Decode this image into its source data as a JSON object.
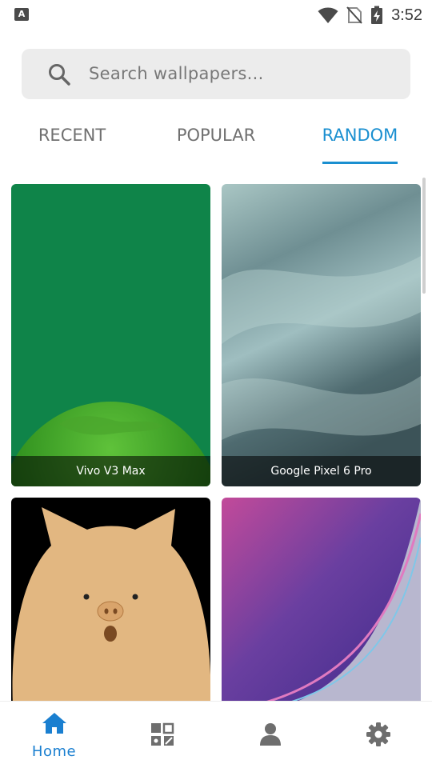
{
  "status_bar": {
    "time": "3:52",
    "left_icon": "A",
    "icons": [
      "wifi-icon",
      "no-sim-icon",
      "battery-charging-icon"
    ]
  },
  "search": {
    "placeholder": "Search wallpapers...",
    "icon": "search-icon"
  },
  "tabs": [
    {
      "label": "RECENT",
      "active": false
    },
    {
      "label": "POPULAR",
      "active": false
    },
    {
      "label": "RANDOM",
      "active": true
    }
  ],
  "wallpapers": [
    {
      "title": "Vivo V3 Max"
    },
    {
      "title": "Google Pixel 6 Pro"
    },
    {
      "title": ""
    },
    {
      "title": ""
    }
  ],
  "bottom_nav": {
    "items": [
      {
        "label": "Home",
        "icon": "home-icon",
        "active": true
      },
      {
        "label": "",
        "icon": "categories-icon",
        "active": false
      },
      {
        "label": "",
        "icon": "profile-icon",
        "active": false
      },
      {
        "label": "",
        "icon": "settings-gear-icon",
        "active": false
      }
    ]
  },
  "colors": {
    "accent": "#1a8fd0",
    "inactive_tab": "#707070",
    "search_bg": "#ececec",
    "nav_icon": "#6e6e6e"
  }
}
